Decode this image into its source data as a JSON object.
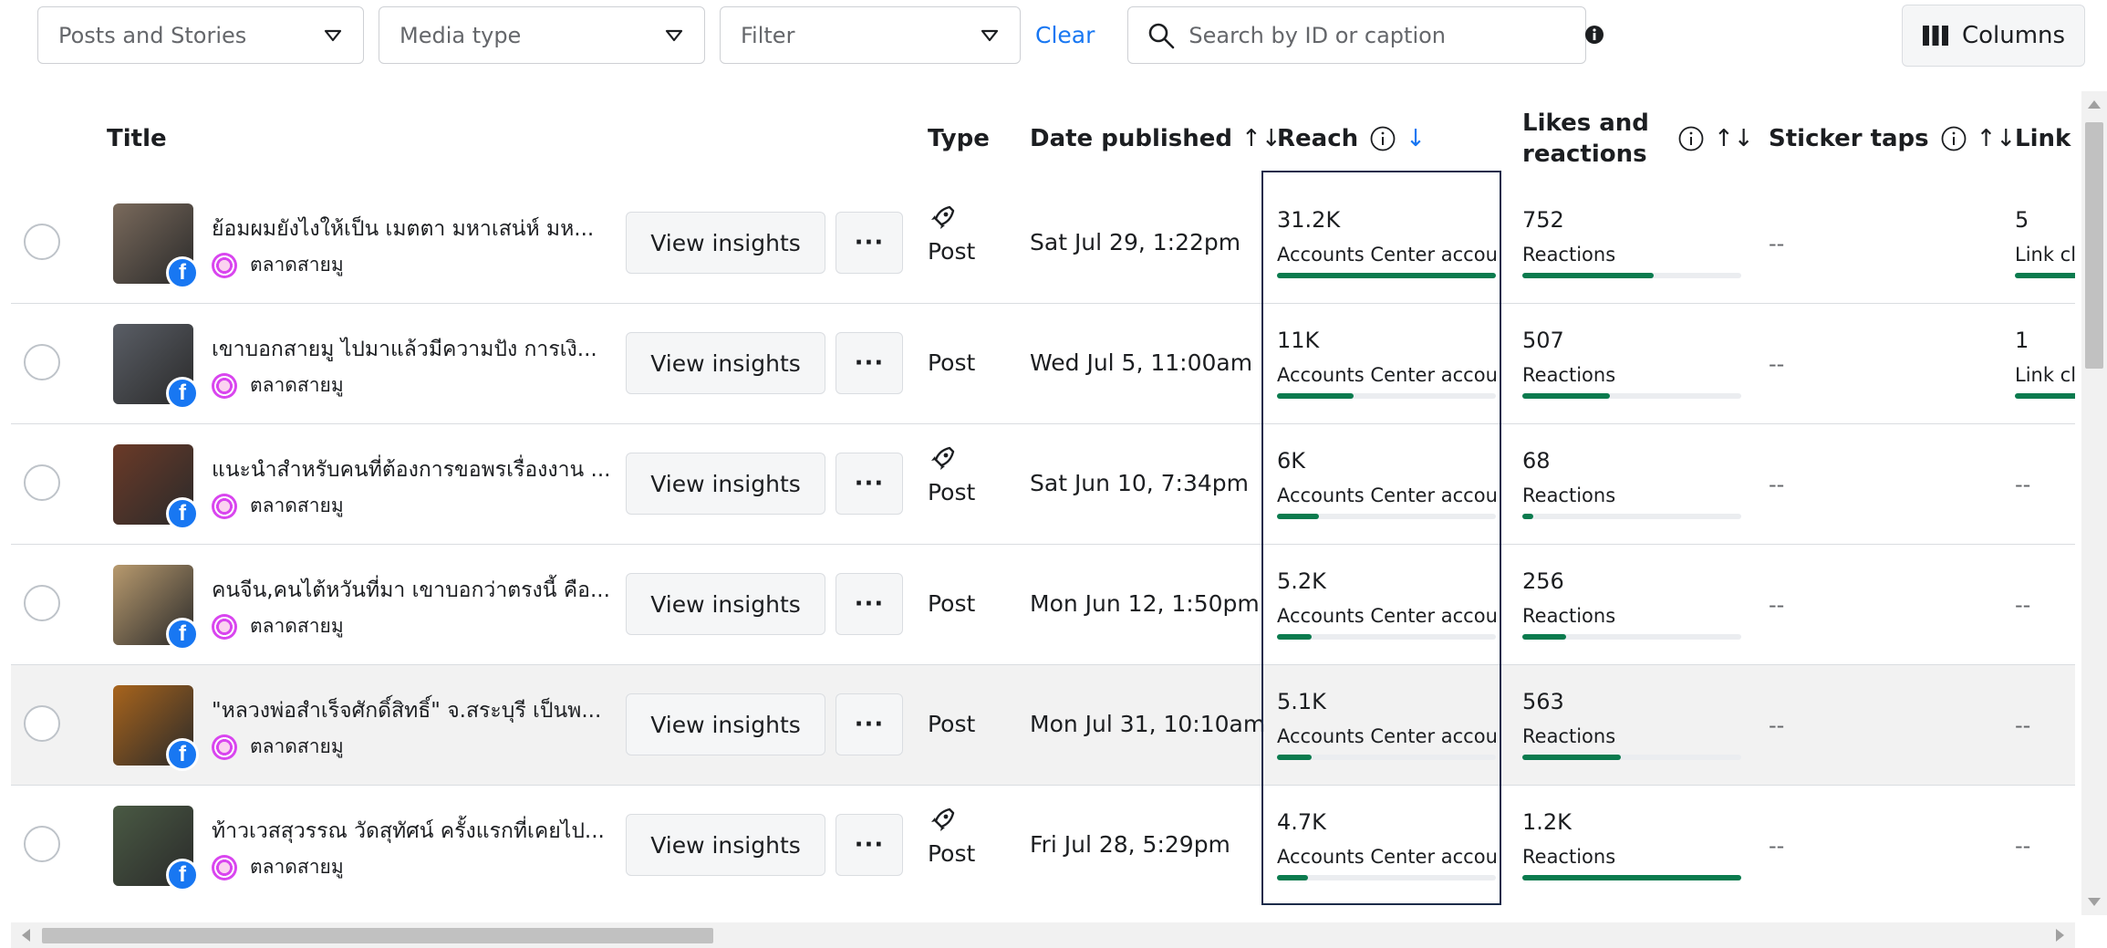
{
  "toolbar": {
    "filters": [
      {
        "label": "Posts and Stories",
        "icon": "triangle-down-icon"
      },
      {
        "label": "Media type",
        "icon": "triangle-down-icon"
      },
      {
        "label": "Filter",
        "icon": "triangle-down-icon"
      }
    ],
    "clear_label": "Clear",
    "search_placeholder": "Search by ID or caption",
    "columns_label": "Columns"
  },
  "table": {
    "headers": {
      "title": "Title",
      "type": "Type",
      "date": "Date published",
      "reach": "Reach",
      "likes_line1": "Likes and",
      "likes_line2": "reactions",
      "sticker": "Sticker taps",
      "link": "Link c"
    },
    "sort_both_glyph": "↑↓",
    "sort_down_glyph": "↓",
    "rows": [
      {
        "title": "ย้อมผมยังไงให้เป็น เมตตา มหาเสน่ห์ มห...",
        "page": "ตลาดสายมู",
        "type": "Post",
        "boosted": true,
        "date": "Sat Jul 29, 1:22pm",
        "reach": "31.2K",
        "reach_sub": "Accounts Center accou...",
        "reach_level": 1.0,
        "likes": "752",
        "likes_sub": "Reactions",
        "likes_level": 0.6,
        "sticker": "--",
        "link": "5",
        "link_sub": "Link clic",
        "link_level": 0.6,
        "thumb_color": "#7a6a5c"
      },
      {
        "title": "เขาบอกสายมู ไปมาแล้วมีความปัง การเงิ...",
        "page": "ตลาดสายมู",
        "type": "Post",
        "boosted": false,
        "date": "Wed Jul 5, 11:00am",
        "reach": "11K",
        "reach_sub": "Accounts Center accou...",
        "reach_level": 0.35,
        "likes": "507",
        "likes_sub": "Reactions",
        "likes_level": 0.4,
        "sticker": "--",
        "link": "1",
        "link_sub": "Link clic",
        "link_level": 0.4,
        "thumb_color": "#5a5e66"
      },
      {
        "title": "แนะนำสำหรับคนที่ต้องการขอพรเรื่องงาน ...",
        "page": "ตลาดสายมู",
        "type": "Post",
        "boosted": true,
        "date": "Sat Jun 10, 7:34pm",
        "reach": "6K",
        "reach_sub": "Accounts Center accou...",
        "reach_level": 0.19,
        "likes": "68",
        "likes_sub": "Reactions",
        "likes_level": 0.05,
        "sticker": "--",
        "link": "--",
        "thumb_color": "#6b3a28"
      },
      {
        "title": "คนจีน,คนไต้หวันที่มา เขาบอกว่าตรงนี้ คือ...",
        "page": "ตลาดสายมู",
        "type": "Post",
        "boosted": false,
        "date": "Mon Jun 12, 1:50pm",
        "reach": "5.2K",
        "reach_sub": "Accounts Center accou...",
        "reach_level": 0.16,
        "likes": "256",
        "likes_sub": "Reactions",
        "likes_level": 0.2,
        "sticker": "--",
        "link": "--",
        "thumb_color": "#b89a6e"
      },
      {
        "title": "\"หลวงพ่อสำเร็จศักดิ์สิทธิ์\" จ.สระบุรี เป็นพ...",
        "page": "ตลาดสายมู",
        "type": "Post",
        "boosted": false,
        "date": "Mon Jul 31, 10:10am",
        "reach": "5.1K",
        "reach_sub": "Accounts Center accou...",
        "reach_level": 0.16,
        "likes": "563",
        "likes_sub": "Reactions",
        "likes_level": 0.45,
        "sticker": "--",
        "link": "--",
        "thumb_color": "#a8641c",
        "hover": true
      },
      {
        "title": "ท้าวเวสสุวรรณ วัดสุทัศน์ ครั้งแรกที่เคยไป...",
        "page": "ตลาดสายมู",
        "type": "Post",
        "boosted": true,
        "date": "Fri Jul 28, 5:29pm",
        "reach": "4.7K",
        "reach_sub": "Accounts Center accou...",
        "reach_level": 0.14,
        "likes": "1.2K",
        "likes_sub": "Reactions",
        "likes_level": 1.0,
        "sticker": "--",
        "link": "--",
        "thumb_color": "#4a5a44"
      }
    ],
    "row_button_label": "View insights",
    "more_label": "···",
    "fb_letter": "f"
  },
  "colors": {
    "accent": "#1877f2",
    "bar_fill": "#0b7b4e",
    "highlight_border": "#1c2b4a"
  }
}
